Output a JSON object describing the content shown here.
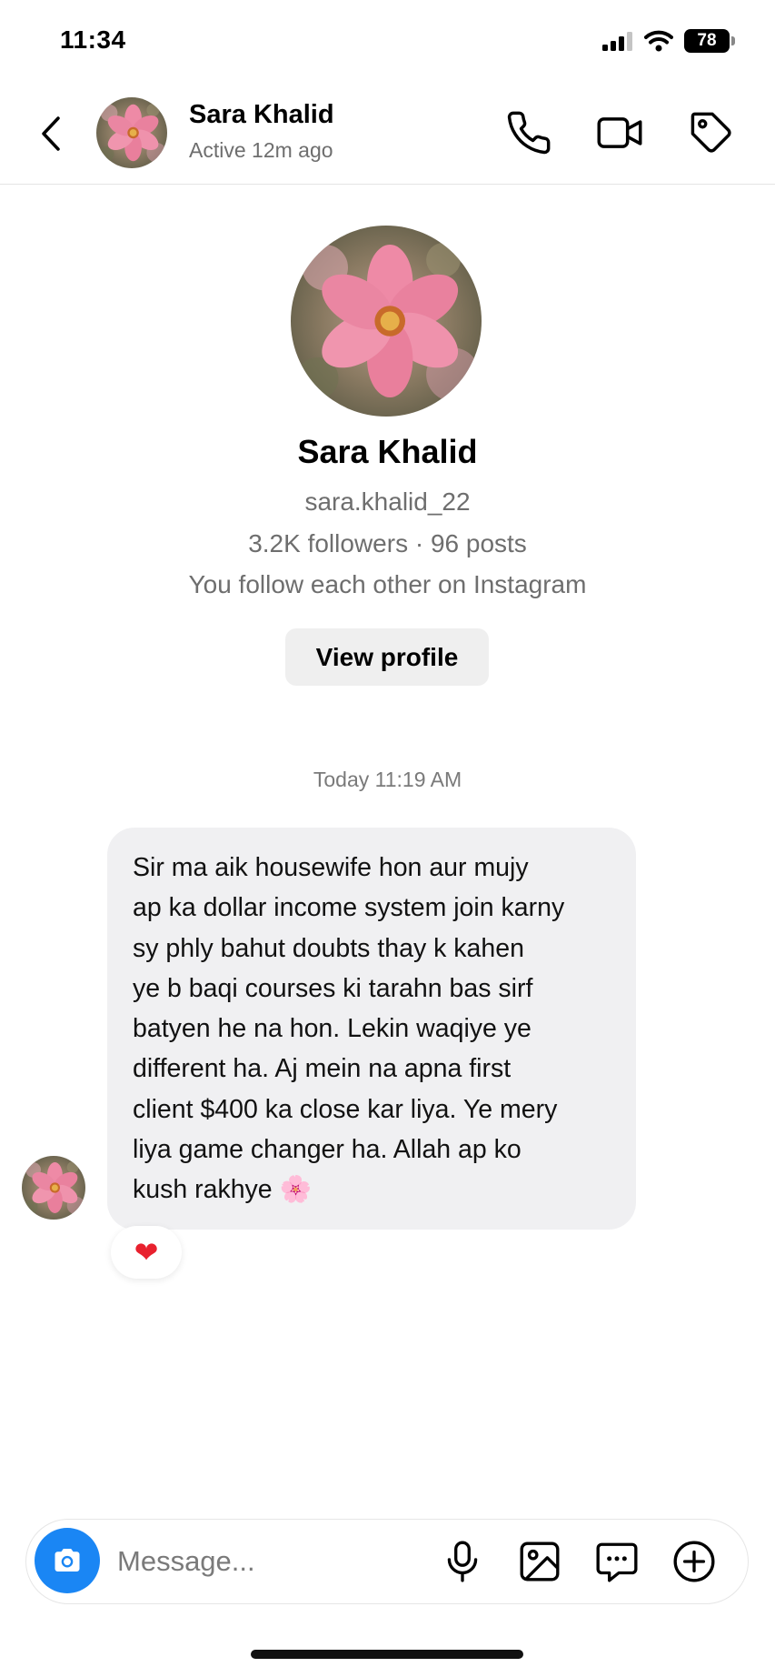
{
  "status_bar": {
    "time": "11:34",
    "battery": "78"
  },
  "header": {
    "name": "Sara Khalid",
    "status": "Active 12m ago"
  },
  "profile": {
    "name": "Sara Khalid",
    "username": "sara.khalid_22",
    "stats": "3.2K followers · 96 posts",
    "mutual": "You follow each other on Instagram",
    "view_profile_label": "View profile"
  },
  "thread": {
    "timestamp": "Today 11:19 AM",
    "message_lines": [
      "Sir ma aik housewife hon aur mujy",
      "ap ka dollar income system join karny",
      "sy phly bahut doubts thay k kahen",
      "ye b baqi courses ki tarahn bas sirf",
      "batyen he na hon. Lekin waqiye ye",
      "different ha. Aj mein na apna first",
      "client $400 ka close kar liya. Ye mery",
      "liya game changer ha. Allah ap ko",
      "kush rakhye 🌸"
    ],
    "reaction": "❤"
  },
  "composer": {
    "placeholder": "Message..."
  },
  "icons": {
    "back": "chevron-left-icon",
    "call": "phone-icon",
    "video": "video-camera-icon",
    "tag": "tag-icon",
    "camera": "camera-icon",
    "mic": "microphone-icon",
    "gallery": "image-icon",
    "sticker": "chat-bubble-icon",
    "plus": "plus-circle-icon"
  },
  "colors": {
    "accent": "#1a86f4",
    "bubble": "#f0f0f2",
    "muted_text": "#6e6e6e",
    "button_bg": "#efefef"
  }
}
